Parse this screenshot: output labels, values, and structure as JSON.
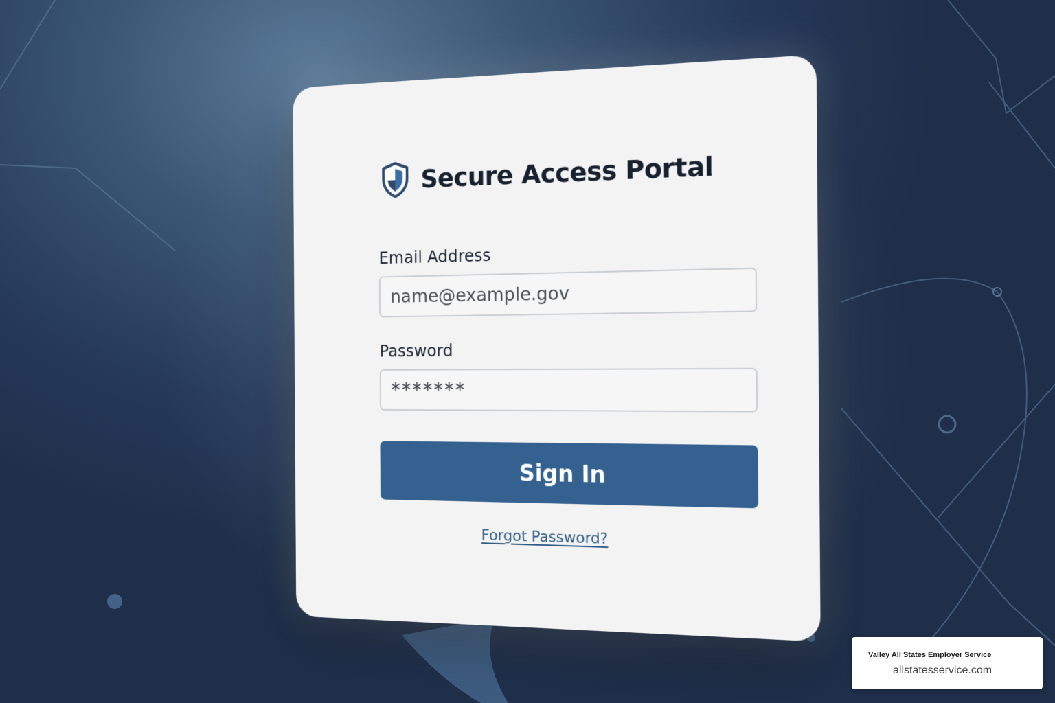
{
  "portal": {
    "title": "Secure Access Portal",
    "icon": "shield-icon"
  },
  "form": {
    "email_label": "Email Address",
    "email_value": "name@example.gov",
    "password_label": "Password",
    "password_value": "*******",
    "signin_label": "Sign In",
    "forgot_label": "Forgot Password?"
  },
  "watermark": {
    "company": "Valley All States Employer Service",
    "url": "allstatesservice.com"
  },
  "colors": {
    "background": "#26395a",
    "card": "#f3f3f3",
    "primary_button": "#34618f",
    "link": "#2d5b88",
    "title_text": "#17202e"
  }
}
